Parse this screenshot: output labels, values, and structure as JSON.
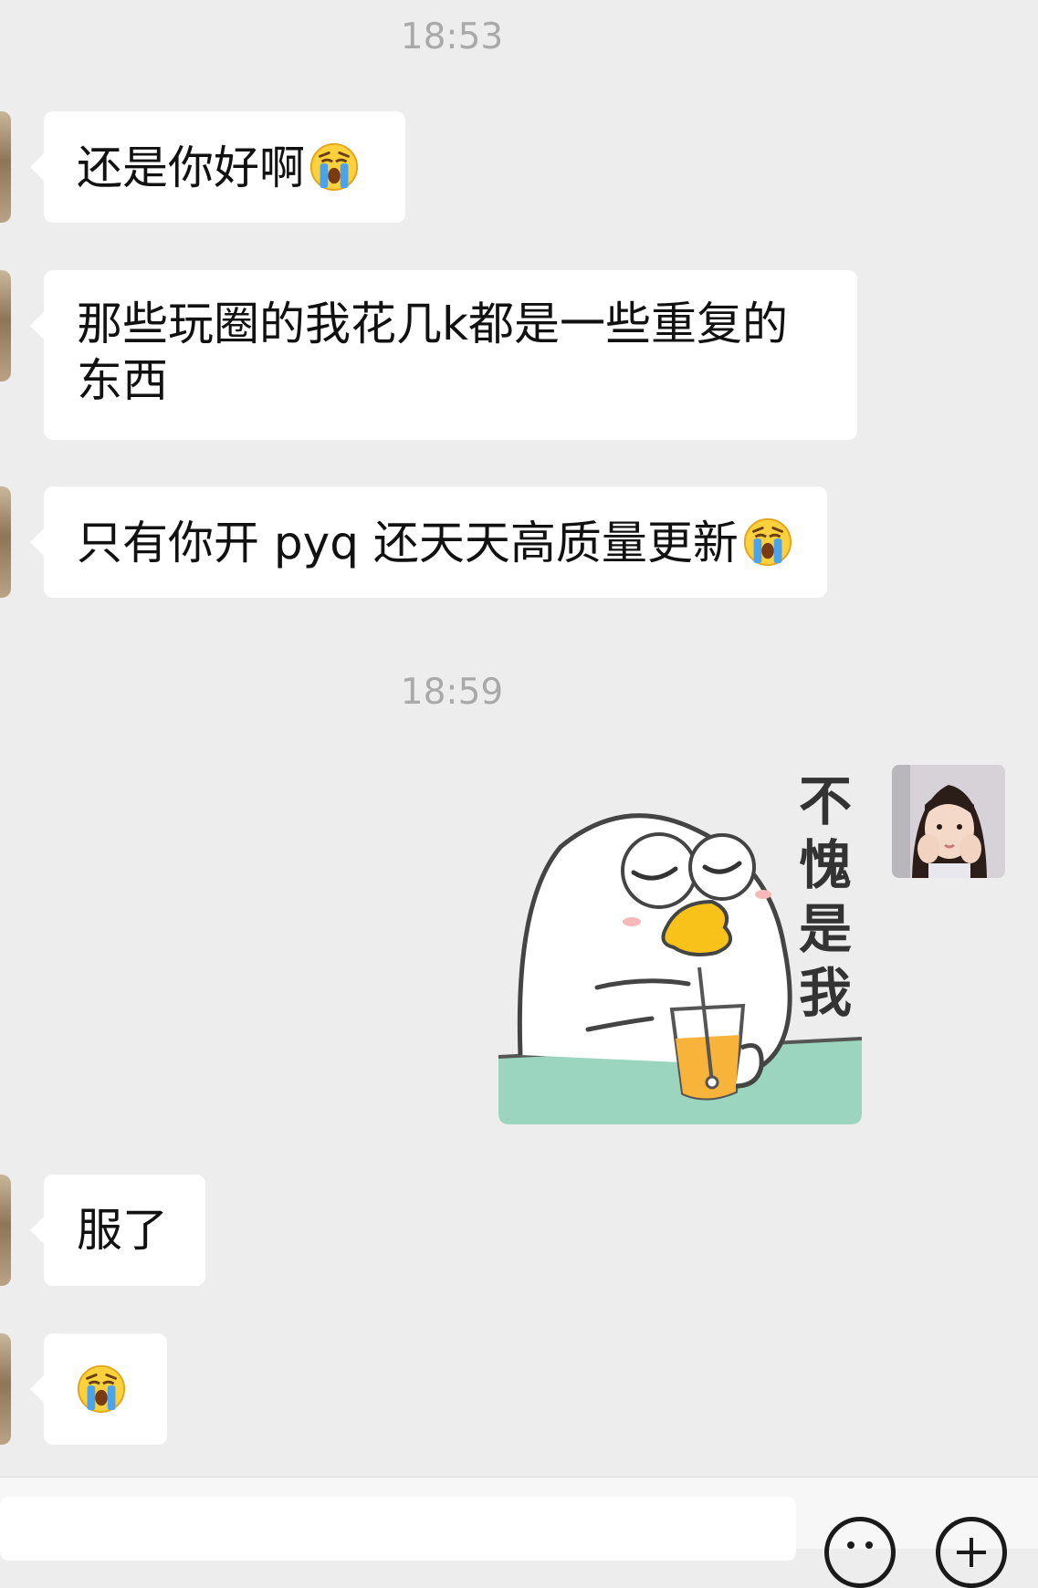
{
  "chat": {
    "time_1": "18:53",
    "msg_1": "还是你好啊",
    "msg_2": "那些玩圈的我花几k都是一些重复的\n东西",
    "msg_3": "只有你开 pyq 还天天高质量更新",
    "time_2": "18:59",
    "sticker_text": "不愧是我",
    "msg_4": "服了",
    "emoji_name": "loudly-crying-face"
  },
  "input_bar": {
    "emoji_icon": "smile-icon",
    "plus_icon": "plus-icon"
  }
}
